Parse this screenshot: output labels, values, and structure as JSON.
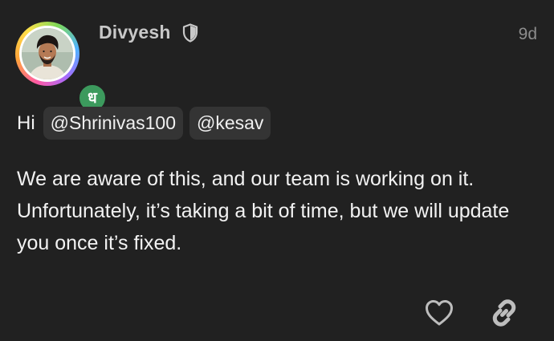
{
  "post": {
    "author": "Divyesh",
    "author_badge_icon": "shield-icon",
    "group_badge_letter": "ध",
    "timestamp": "9d",
    "greeting": "Hi",
    "mentions": [
      "@Shrinivas100",
      "@kesav"
    ],
    "body": "We are aware of this, and our team is working on it. Unfortunately, it’s taking a bit of time, but we will update you once it’s fixed."
  },
  "actions": {
    "like_icon": "heart-icon",
    "share_icon": "link-icon"
  },
  "colors": {
    "background": "#212121",
    "group_badge": "#3c9a5d",
    "mention_bg": "#343434"
  }
}
